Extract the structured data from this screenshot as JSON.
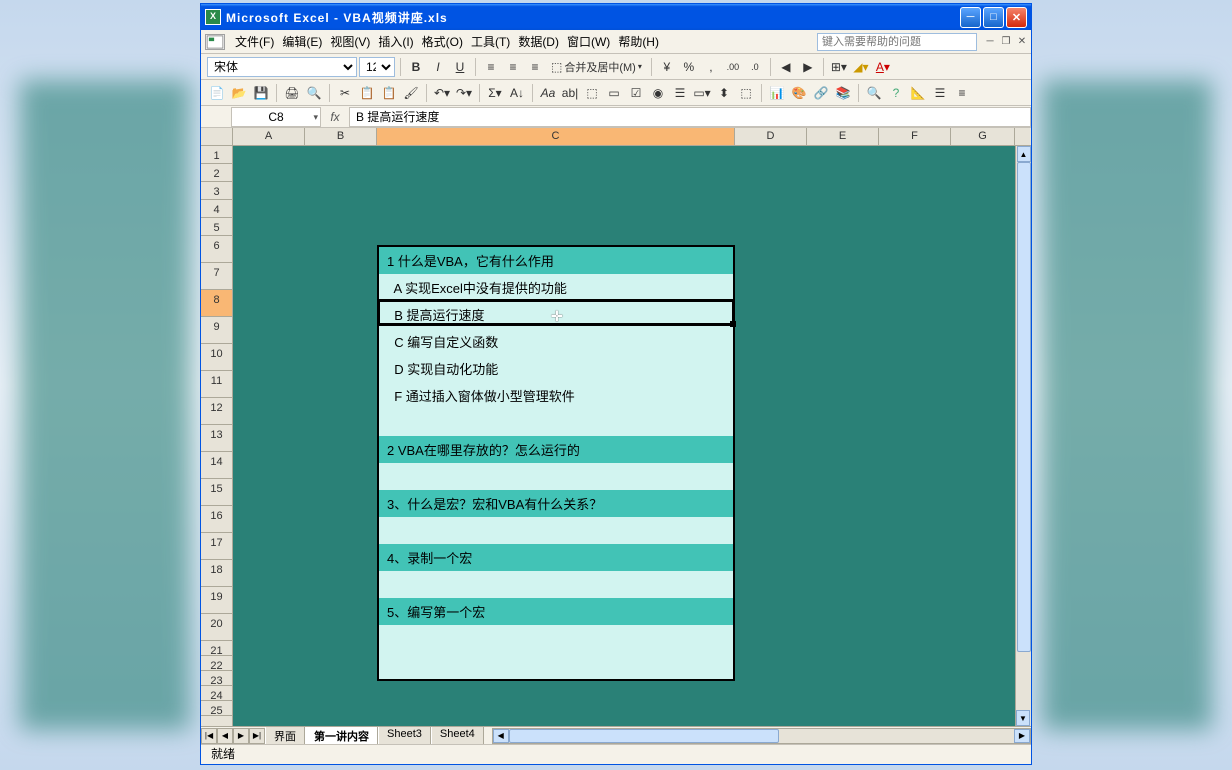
{
  "title": "Microsoft Excel - VBA视频讲座.xls",
  "menus": [
    "文件(F)",
    "编辑(E)",
    "视图(V)",
    "插入(I)",
    "格式(O)",
    "工具(T)",
    "数据(D)",
    "窗口(W)",
    "帮助(H)"
  ],
  "help_placeholder": "键入需要帮助的问题",
  "font": "宋体",
  "font_size": "12",
  "merge_label": "合并及居中(M)",
  "name_box": "C8",
  "formula": "  B 提高运行速度",
  "columns": [
    "A",
    "B",
    "C",
    "D",
    "E",
    "F",
    "G"
  ],
  "col_widths": [
    "col-a",
    "col-b",
    "col-c",
    "col-d",
    "col-e",
    "col-f",
    "col-g"
  ],
  "rows": [
    1,
    2,
    3,
    4,
    5,
    6,
    7,
    8,
    9,
    10,
    11,
    12,
    13,
    14,
    15,
    16,
    17,
    18,
    19,
    20,
    21,
    22,
    23,
    24,
    25
  ],
  "selected_row": 8,
  "selected_col": "C",
  "content": [
    {
      "text": "1 什么是VBA，它有什么作用",
      "cls": "row-h"
    },
    {
      "text": "  A 实现Excel中没有提供的功能",
      "cls": "row-l"
    },
    {
      "text": "  B 提高运行速度",
      "cls": "row-l sel"
    },
    {
      "text": "  C 编写自定义函数",
      "cls": "row-l"
    },
    {
      "text": "  D 实现自动化功能",
      "cls": "row-l"
    },
    {
      "text": "  F 通过插入窗体做小型管理软件",
      "cls": "row-l"
    },
    {
      "text": "",
      "cls": "row-l"
    },
    {
      "text": "2 VBA在哪里存放的？怎么运行的",
      "cls": "row-h"
    },
    {
      "text": "",
      "cls": "row-l"
    },
    {
      "text": "3、什么是宏？宏和VBA有什么关系？",
      "cls": "row-h"
    },
    {
      "text": "",
      "cls": "row-l"
    },
    {
      "text": "4、录制一个宏",
      "cls": "row-h"
    },
    {
      "text": "",
      "cls": "row-l"
    },
    {
      "text": "5、编写第一个宏",
      "cls": "row-h"
    },
    {
      "text": "",
      "cls": "row-l"
    },
    {
      "text": "",
      "cls": "row-l"
    }
  ],
  "sheets": [
    "界面",
    "第一讲内容",
    "Sheet3",
    "Sheet4"
  ],
  "active_sheet": "第一讲内容",
  "status": "就绪"
}
